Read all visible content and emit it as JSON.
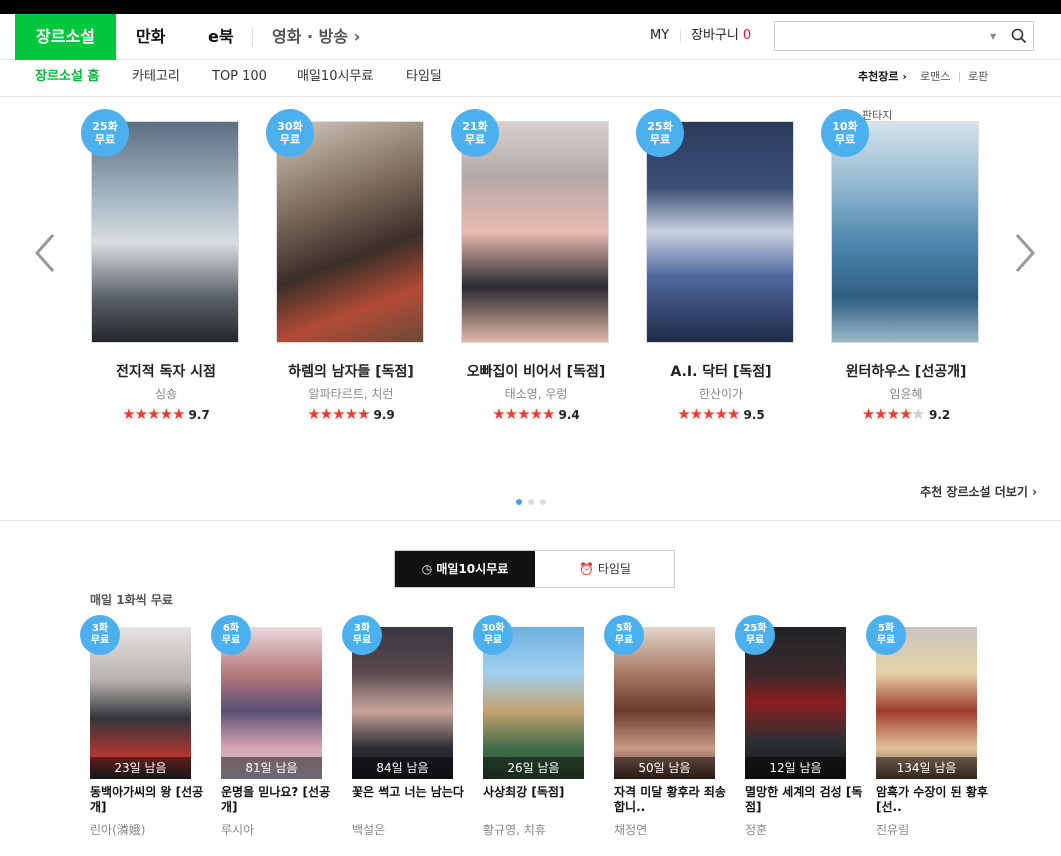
{
  "gnb": {
    "tabs": [
      "장르소설",
      "만화",
      "e북"
    ],
    "movie": "영화 · 방송",
    "my": "MY",
    "cart": "장바구니",
    "cart_count": "0",
    "search_placeholder": ""
  },
  "lnb": {
    "items": [
      "장르소설 홈",
      "카테고리",
      "TOP 100",
      "매일10시무료",
      "타임딜"
    ],
    "right": [
      "추천장르",
      "로맨스",
      "로판"
    ]
  },
  "carousel": {
    "genre_label": "판타지",
    "items": [
      {
        "badge_n": "25화",
        "badge_t": "무료",
        "title": "전지적 독자 시점",
        "author": "싱숑",
        "stars": "★★★★★",
        "score": "9.7"
      },
      {
        "badge_n": "30화",
        "badge_t": "무료",
        "title": "하렘의 남자들 [독점]",
        "author": "알파타르트, 치런",
        "stars": "★★★★★",
        "score": "9.9"
      },
      {
        "badge_n": "21화",
        "badge_t": "무료",
        "title": "오빠집이 비어서 [독점]",
        "author": "태소영, 우렁",
        "stars": "★★★★★",
        "score": "9.4"
      },
      {
        "badge_n": "25화",
        "badge_t": "무료",
        "title": "A.I. 닥터 [독점]",
        "author": "한산이가",
        "stars": "★★★★★",
        "score": "9.5"
      },
      {
        "badge_n": "10화",
        "badge_t": "무료",
        "title": "윈터하우스 [선공개]",
        "author": "임윤혜",
        "stars": "★★★★",
        "score": "9.2"
      }
    ],
    "more": "추천 장르소설 더보기 ›"
  },
  "free": {
    "tab_on": "매일10시무료",
    "tab_off": "타임딜",
    "label": "매일 1화씩 무료",
    "items": [
      {
        "badge_n": "3화",
        "badge_t": "무료",
        "remain": "23일 남음",
        "title": "동백아가씨의 왕 [선공개]",
        "author": "린아(潾娥)"
      },
      {
        "badge_n": "6화",
        "badge_t": "무료",
        "remain": "81일 남음",
        "title": "운명을 믿나요? [선공개]",
        "author": "루시아"
      },
      {
        "badge_n": "3화",
        "badge_t": "무료",
        "remain": "84일 남음",
        "title": "꽃은 썩고 너는 남는다",
        "author": "백설은"
      },
      {
        "badge_n": "30화",
        "badge_t": "무료",
        "remain": "26일 남음",
        "title": "사상최강 [독점]",
        "author": "황규영, 치휴"
      },
      {
        "badge_n": "5화",
        "badge_t": "무료",
        "remain": "50일 남음",
        "title": "자격 미달 황후라 죄송합니..",
        "author": "채정연"
      },
      {
        "badge_n": "25화",
        "badge_t": "무료",
        "remain": "12일 남음",
        "title": "멸망한 세계의 검성 [독점]",
        "author": "정훈"
      },
      {
        "badge_n": "5화",
        "badge_t": "무료",
        "remain": "134일 남음",
        "title": "암흑가 수장이 된 황후 [선..",
        "author": "진유림"
      }
    ]
  }
}
